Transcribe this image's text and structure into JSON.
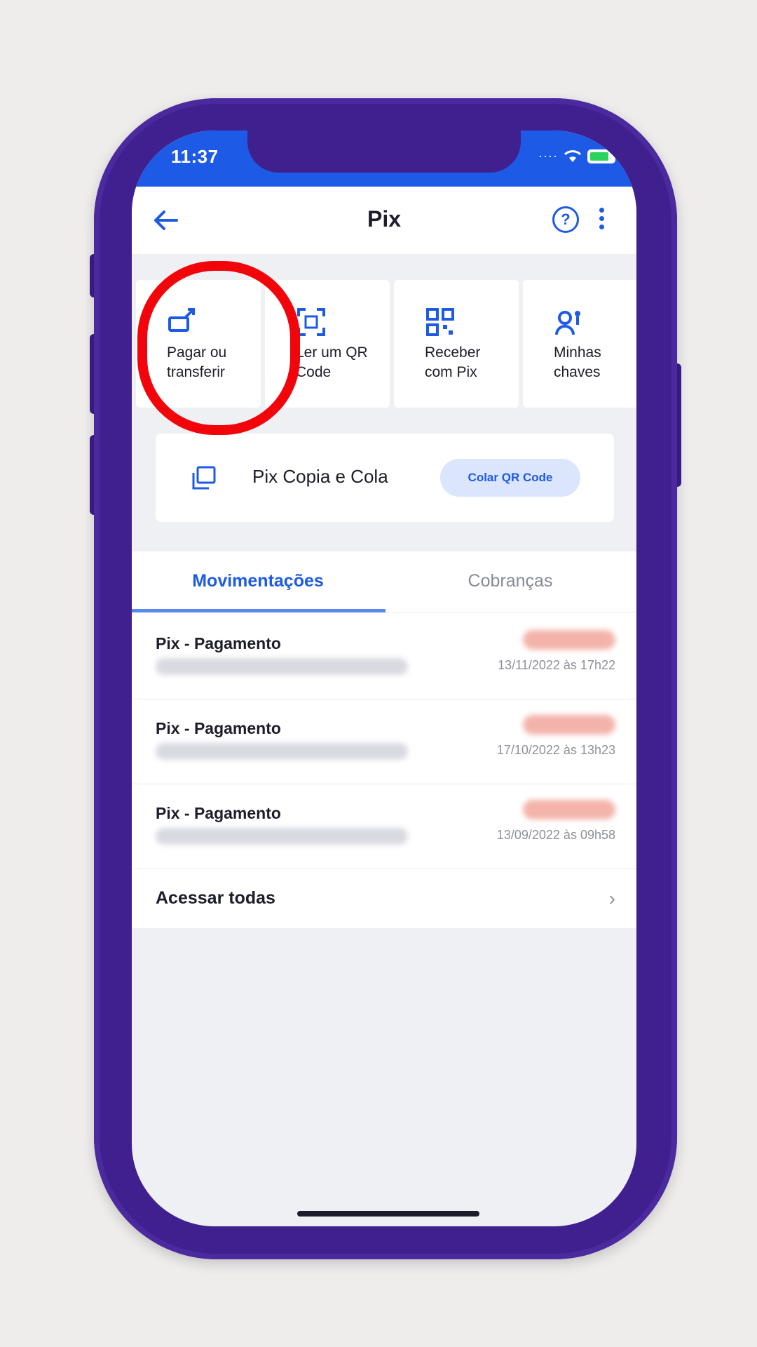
{
  "status_bar": {
    "time": "11:37"
  },
  "header": {
    "title": "Pix"
  },
  "actions": [
    {
      "label_line1": "Pagar ou",
      "label_line2": "transferir",
      "icon": "pay-transfer-icon"
    },
    {
      "label_line1": "Ler um QR",
      "label_line2": "Code",
      "icon": "qr-scan-icon"
    },
    {
      "label_line1": "Receber",
      "label_line2": "com Pix",
      "icon": "qr-code-icon"
    },
    {
      "label_line1": "Minhas",
      "label_line2": "chaves",
      "icon": "key-user-icon"
    }
  ],
  "copy_paste": {
    "label": "Pix Copia e Cola",
    "button": "Colar QR Code"
  },
  "tabs": {
    "active": "Movimentações",
    "inactive": "Cobranças"
  },
  "transactions": [
    {
      "title": "Pix - Pagamento",
      "date": "13/11/2022 às 17h22"
    },
    {
      "title": "Pix - Pagamento",
      "date": "17/10/2022 às 13h23"
    },
    {
      "title": "Pix - Pagamento",
      "date": "13/09/2022 às 09h58"
    }
  ],
  "see_all": {
    "label": "Acessar todas"
  },
  "colors": {
    "brand_blue": "#1d5be6",
    "phone_frame": "#40208f",
    "highlight_red": "#f2050a"
  }
}
